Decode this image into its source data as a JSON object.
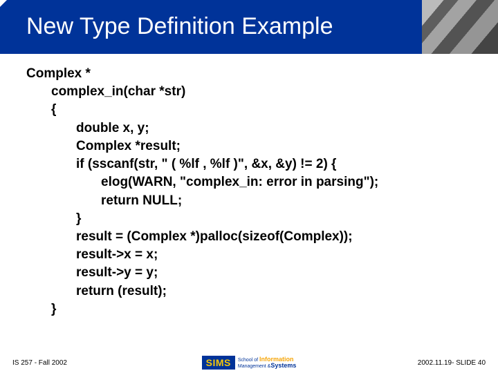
{
  "title": "New Type Definition Example",
  "code": {
    "l0": "Complex *",
    "l1": "complex_in(char *str)",
    "l2": "{",
    "l3": "double x, y;",
    "l4": "Complex *result;",
    "l5": "if (sscanf(str, \" ( %lf , %lf )\", &x, &y) != 2) {",
    "l6": "elog(WARN, \"complex_in: error in parsing\");",
    "l7": "return NULL;",
    "l8": "}",
    "l9": "result = (Complex *)palloc(sizeof(Complex));",
    "l10": "result->x = x;",
    "l11": "result->y = y;",
    "l12": "return (result);",
    "l13": "}"
  },
  "footer": {
    "left": "IS 257 - Fall 2002",
    "right": "2002.11.19- SLIDE 40",
    "logo_main": "SIMS",
    "logo_school": "School of",
    "logo_info": "Information",
    "logo_mgmt": "Management",
    "logo_amp": "&",
    "logo_sys": "Systems"
  }
}
